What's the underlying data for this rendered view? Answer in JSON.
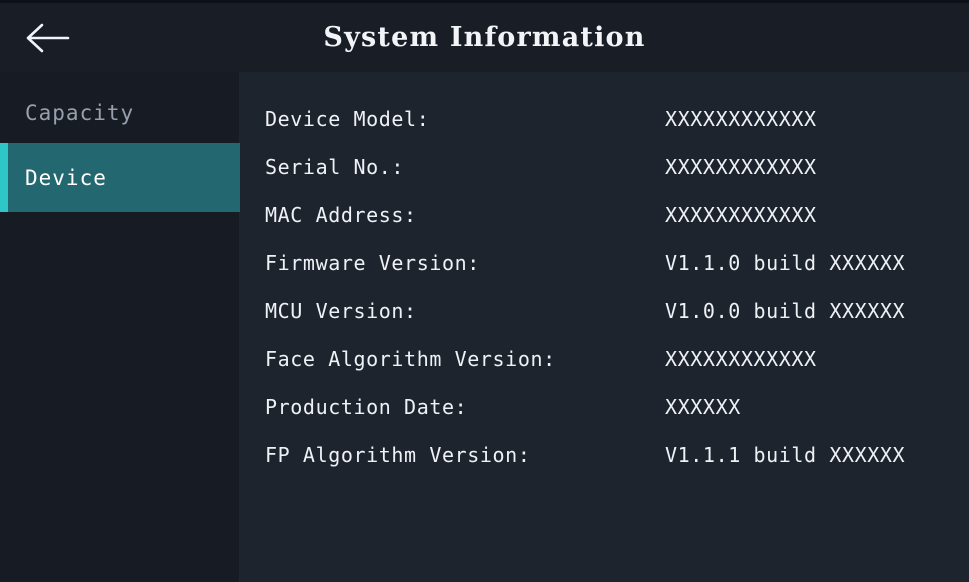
{
  "header": {
    "title": "System Information",
    "back_icon": "arrow-left-icon"
  },
  "sidebar": {
    "items": [
      {
        "label": "Capacity",
        "active": false
      },
      {
        "label": "Device",
        "active": true
      }
    ]
  },
  "colors": {
    "background": "#1e242e",
    "header_background": "#191d26",
    "sidebar_background": "#171c24",
    "active_item_background": "#236870",
    "active_item_accent": "#2ec6c6",
    "text_primary": "#eef1f5",
    "text_muted": "#97a0ac"
  },
  "main": {
    "rows": [
      {
        "label": "Device Model:",
        "value": "XXXXXXXXXXXX"
      },
      {
        "label": "Serial No.:",
        "value": "XXXXXXXXXXXX"
      },
      {
        "label": "MAC Address:",
        "value": "XXXXXXXXXXXX"
      },
      {
        "label": "Firmware Version:",
        "value": "V1.1.0 build XXXXXX"
      },
      {
        "label": "MCU Version:",
        "value": "V1.0.0 build XXXXXX"
      },
      {
        "label": "Face Algorithm Version:",
        "value": "XXXXXXXXXXXX"
      },
      {
        "label": "Production Date:",
        "value": "XXXXXX"
      },
      {
        "label": "FP Algorithm Version:",
        "value": "V1.1.1 build XXXXXX"
      }
    ]
  }
}
